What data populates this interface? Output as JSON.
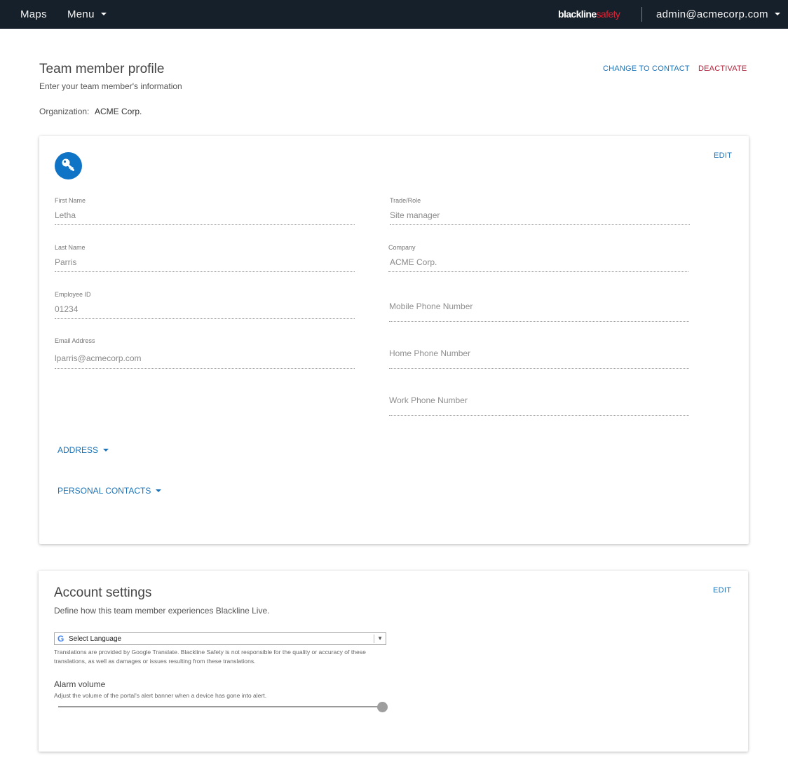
{
  "nav": {
    "maps": "Maps",
    "menu": "Menu",
    "brand_black": "blackline",
    "brand_safety": "safety",
    "user": "admin@acmecorp.com"
  },
  "header": {
    "title": "Team member profile",
    "subtitle": "Enter your team member's information",
    "org_label": "Organization:",
    "org_value": "ACME Corp.",
    "change_to_contact": "CHANGE TO CONTACT",
    "deactivate": "DEACTIVATE"
  },
  "profile": {
    "edit": "EDIT",
    "avatar_icon": "key-icon",
    "first_name": {
      "label": "First Name",
      "value": "Letha"
    },
    "last_name": {
      "label": "Last Name",
      "value": "Parris"
    },
    "employee_id": {
      "label": "Employee ID",
      "value": "01234"
    },
    "email": {
      "label": "Email Address",
      "value": "lparris@acmecorp.com"
    },
    "trade_role": {
      "label": "Trade/Role",
      "value": "Site manager"
    },
    "company": {
      "label": "Company",
      "value": "ACME Corp."
    },
    "mobile_phone": {
      "placeholder": "Mobile Phone Number"
    },
    "home_phone": {
      "placeholder": "Home Phone Number"
    },
    "work_phone": {
      "placeholder": "Work Phone Number"
    },
    "address": "ADDRESS",
    "personal_contacts": "PERSONAL CONTACTS"
  },
  "account": {
    "title": "Account settings",
    "subtitle": "Define how this team member experiences Blackline Live.",
    "edit": "EDIT",
    "language_select": "Select Language",
    "language_arrow": "▼",
    "google_g": "G",
    "disclaimer": "Translations are provided by Google Translate. Blackline Safety is not responsible for the quality or accuracy of these translations, as well as damages or issues resulting from these translations.",
    "alarm_title": "Alarm volume",
    "alarm_sub": "Adjust the volume of the portal's alert banner when a device has gone into alert.",
    "alarm_volume_fraction": 1.0
  },
  "colors": {
    "nav_bg": "#16202a",
    "accent_blue": "#1a73b8",
    "avatar_blue": "#0f73c6",
    "danger": "#b0233a",
    "brand_red": "#e02334"
  }
}
